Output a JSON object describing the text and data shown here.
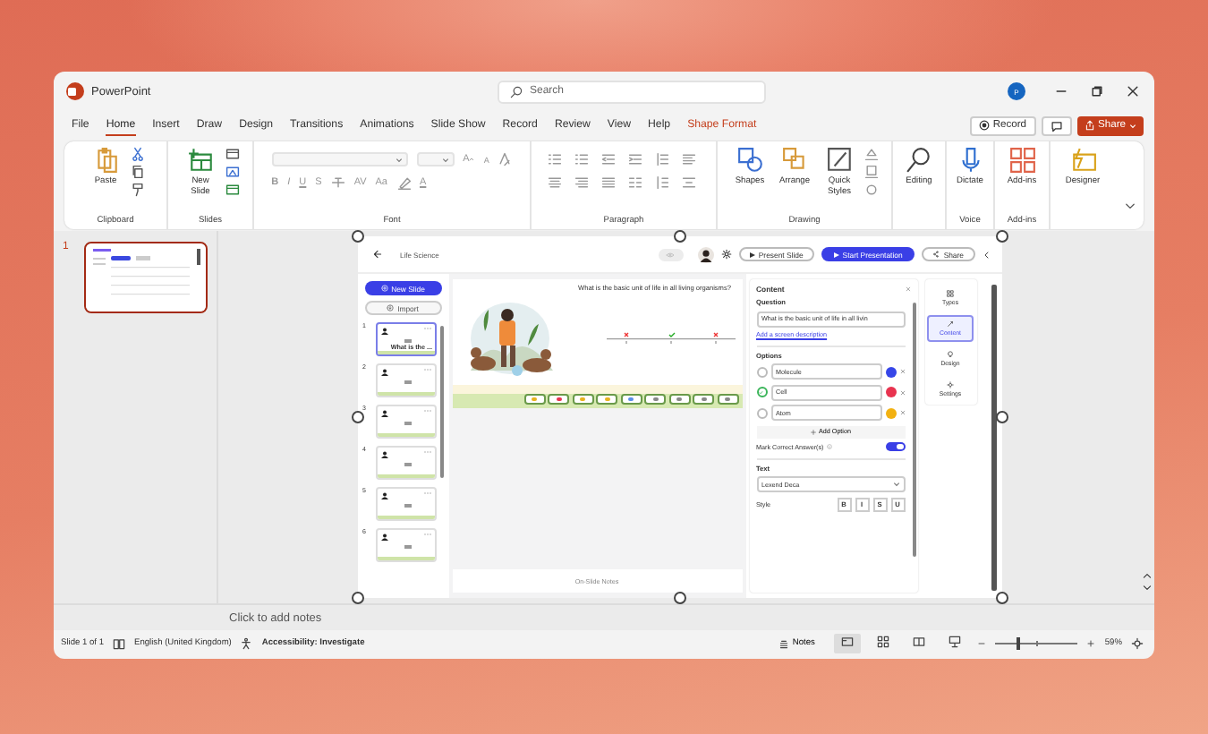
{
  "app": {
    "title": "PowerPoint"
  },
  "search": {
    "placeholder": "Search"
  },
  "account": {
    "initial": "P"
  },
  "menu": [
    {
      "label": "File",
      "selected": false,
      "contextual": false
    },
    {
      "label": "Home",
      "selected": true,
      "contextual": false
    },
    {
      "label": "Insert",
      "selected": false,
      "contextual": false
    },
    {
      "label": "Draw",
      "selected": false,
      "contextual": false
    },
    {
      "label": "Design",
      "selected": false,
      "contextual": false
    },
    {
      "label": "Transitions",
      "selected": false,
      "contextual": false
    },
    {
      "label": "Animations",
      "selected": false,
      "contextual": false
    },
    {
      "label": "Slide Show",
      "selected": false,
      "contextual": false
    },
    {
      "label": "Record",
      "selected": false,
      "contextual": false
    },
    {
      "label": "Review",
      "selected": false,
      "contextual": false
    },
    {
      "label": "View",
      "selected": false,
      "contextual": false
    },
    {
      "label": "Help",
      "selected": false,
      "contextual": false
    },
    {
      "label": "Shape Format",
      "selected": false,
      "contextual": true
    }
  ],
  "header_actions": {
    "record": "Record",
    "share": "Share"
  },
  "ribbon": [
    {
      "kind": "clipboard",
      "label": "Clipboard",
      "buttons": [
        "Paste"
      ]
    },
    {
      "kind": "slides",
      "label": "Slides",
      "buttons": [
        "New Slide"
      ]
    },
    {
      "kind": "font",
      "label": "Font",
      "letters": [
        "A",
        "A",
        "B",
        "I",
        "U",
        "S",
        "AV",
        "Aa",
        "A"
      ]
    },
    {
      "kind": "paragraph",
      "label": "Paragraph"
    },
    {
      "kind": "drawing",
      "label": "Drawing",
      "buttons": [
        "Shapes",
        "Arrange",
        "Quick Styles"
      ]
    },
    {
      "kind": "editing",
      "buttons": [
        "Editing"
      ]
    },
    {
      "kind": "voice",
      "label": "Voice",
      "buttons": [
        "Dictate"
      ]
    },
    {
      "kind": "addins",
      "label": "Add-ins",
      "buttons": [
        "Add-ins"
      ]
    },
    {
      "kind": "designer",
      "buttons": [
        "Designer"
      ]
    }
  ],
  "thumbnails": [
    {
      "number": "1",
      "selected": true
    }
  ],
  "slide": {
    "title": "Life Science",
    "present": "Present Slide",
    "start": "Start Presentation",
    "share": "Share",
    "new_slide": "New Slide",
    "import": "Import",
    "slides": [
      {
        "number": "1",
        "selected": true,
        "caption": "What is the ..."
      },
      {
        "number": "2",
        "selected": false
      },
      {
        "number": "3",
        "selected": false
      },
      {
        "number": "4",
        "selected": false
      },
      {
        "number": "5",
        "selected": false
      },
      {
        "number": "6",
        "selected": false
      }
    ],
    "question": "What is the basic unit of life in all living organisms?",
    "notes": "On-Slide Notes",
    "panel": {
      "title": "Content",
      "question_label": "Question",
      "question_value": "What is the basic unit of life in all livin",
      "description_link": "Add a screen description",
      "options_label": "Options",
      "options": [
        {
          "label": "Molecule",
          "correct": false,
          "color": "#3646e8"
        },
        {
          "label": "Cell",
          "correct": true,
          "color": "#e8334f"
        },
        {
          "label": "Atom",
          "correct": false,
          "color": "#f2b111"
        }
      ],
      "add_option": "Add Option",
      "mark_correct": {
        "label": "Mark Correct Answer(s)",
        "on": true
      },
      "text_label": "Text",
      "font_value": "Lexend Deca",
      "style_label": "Style",
      "style_buttons": [
        "B",
        "I",
        "S",
        "U"
      ]
    },
    "side_tabs": [
      {
        "label": "Types",
        "selected": false
      },
      {
        "label": "Content",
        "selected": true
      },
      {
        "label": "Design",
        "selected": false
      },
      {
        "label": "Settings",
        "selected": false
      }
    ]
  },
  "notes": {
    "placeholder": "Click to add notes"
  },
  "status_bar": {
    "slide": "Slide 1 of 1",
    "language": "English (United Kingdom)",
    "accessibility": "Accessibility: Investigate",
    "notes": "Notes",
    "views": [
      {
        "selected": true
      },
      {
        "selected": false
      },
      {
        "selected": false
      },
      {
        "selected": false
      }
    ],
    "zoom": {
      "level": 0.27,
      "reading": "59%"
    }
  }
}
